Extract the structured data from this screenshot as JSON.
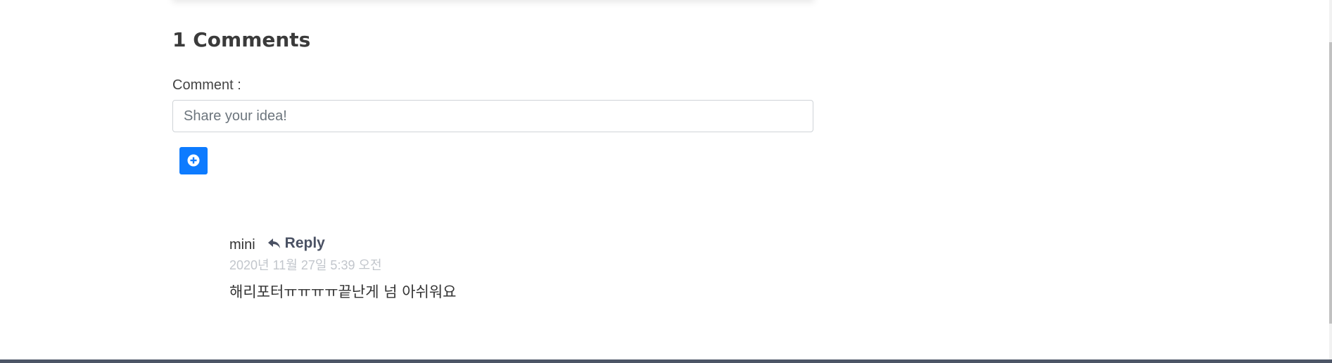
{
  "comments_section": {
    "title": "1 Comments",
    "form": {
      "label": "Comment :",
      "input_value": "",
      "placeholder": "Share your idea!",
      "add_button_icon": "plus-circle-icon"
    },
    "comments": [
      {
        "author": "mini",
        "reply_label": "Reply",
        "reply_icon": "reply-arrow-icon",
        "date": "2020년 11월 27일 5:39 오전",
        "text": "해리포터ㅠㅠㅠㅠ끝난게 넘 아쉬워요"
      }
    ]
  },
  "colors": {
    "accent": "#0d7bff",
    "footer": "#4c5566",
    "date_text": "#c2c6cc"
  }
}
